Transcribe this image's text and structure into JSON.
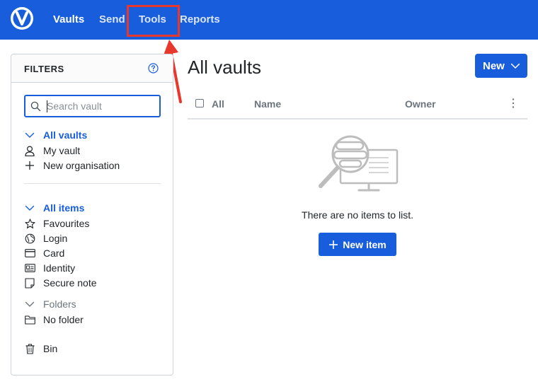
{
  "nav": {
    "items": [
      {
        "label": "Vaults"
      },
      {
        "label": "Send"
      },
      {
        "label": "Tools"
      },
      {
        "label": "Reports"
      }
    ]
  },
  "filters": {
    "title": "FILTERS",
    "search_placeholder": "Search vault",
    "vaults_group": "All vaults",
    "vaults": [
      "My vault",
      "New organisation"
    ],
    "items_group": "All items",
    "types": [
      "Favourites",
      "Login",
      "Card",
      "Identity",
      "Secure note"
    ],
    "folders_group": "Folders",
    "folders": [
      "No folder"
    ],
    "bin": "Bin"
  },
  "main": {
    "title": "All vaults",
    "new_button": "New",
    "columns": {
      "all": "All",
      "name": "Name",
      "owner": "Owner"
    },
    "empty_text": "There are no items to list.",
    "new_item_button": "New item"
  },
  "colors": {
    "brand": "#175ddc",
    "annotation": "#e8372c"
  }
}
